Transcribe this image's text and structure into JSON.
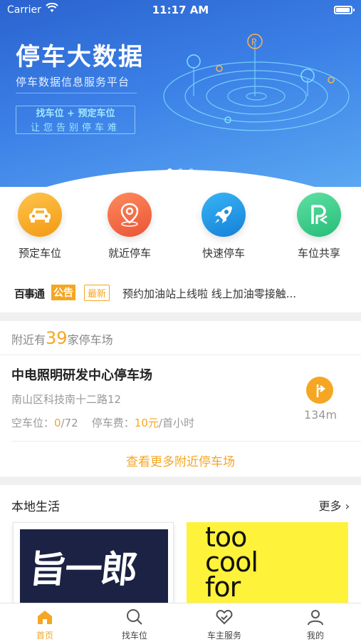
{
  "status_bar": {
    "carrier": "Carrier",
    "time": "11:17 AM"
  },
  "banner": {
    "title": "停车大数据",
    "subtitle": "停车数据信息服务平台",
    "slogan_line1": "找车位 + 预定车位",
    "slogan_line2": "让您告别停车难",
    "page_indicator": {
      "count": 3,
      "active_index": 0
    }
  },
  "quick_actions": [
    {
      "label": "预定车位",
      "icon": "car-icon",
      "color": "#f7a51c"
    },
    {
      "label": "就近停车",
      "icon": "location-pin-icon",
      "color": "#f26a4b"
    },
    {
      "label": "快速停车",
      "icon": "rocket-icon",
      "color": "#1e9be8"
    },
    {
      "label": "车位共享",
      "icon": "parking-share-icon",
      "color": "#3ecf8e"
    }
  ],
  "notice": {
    "brand": "百事通",
    "brand_tag": "公告",
    "badge": "最新",
    "text": "预约加油站上线啦 线上加油零接触..."
  },
  "nearby": {
    "prefix": "附近有",
    "count": "39",
    "suffix": "家停车场",
    "lot": {
      "name": "中电照明研发中心停车场",
      "address": "南山区科技南十二路12",
      "free_label": "空车位：",
      "free_value": "0",
      "total": "/72",
      "fee_label": "停车费：",
      "fee_value": "10元",
      "fee_unit": "/首小时",
      "distance": "134m"
    },
    "more_link": "查看更多附近停车场"
  },
  "local_life": {
    "title": "本地生活",
    "more": "更多",
    "card1_text": "旨一郎",
    "card2_lines": [
      "too",
      "cool",
      "for"
    ]
  },
  "tabbar": [
    {
      "label": "首页",
      "icon": "home-icon",
      "active": true
    },
    {
      "label": "找车位",
      "icon": "search-icon",
      "active": false
    },
    {
      "label": "车主服务",
      "icon": "heart-service-icon",
      "active": false
    },
    {
      "label": "我的",
      "icon": "user-icon",
      "active": false
    }
  ],
  "colors": {
    "accent": "#f5a623",
    "banner_start": "#2a63cf",
    "banner_end": "#5aa7f2"
  }
}
